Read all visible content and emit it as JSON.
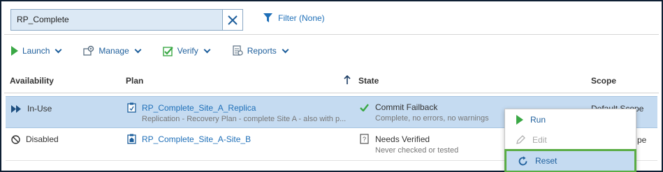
{
  "search": {
    "value": "RP_Complete"
  },
  "filter": {
    "label": "Filter (None)"
  },
  "toolbar": {
    "launch": "Launch",
    "manage": "Manage",
    "verify": "Verify",
    "reports": "Reports"
  },
  "columns": {
    "availability": "Availability",
    "plan": "Plan",
    "state": "State",
    "scope": "Scope"
  },
  "rows": [
    {
      "availability": "In-Use",
      "plan_name": "RP_Complete_Site_A_Replica",
      "plan_desc": "Replication - Recovery Plan - complete Site A - also with p...",
      "state": "Commit Failback",
      "state_detail": "Complete, no errors, no warnings",
      "scope": "Default Scope"
    },
    {
      "availability": "Disabled",
      "plan_name": "RP_Complete_Site_A-Site_B",
      "plan_desc": "",
      "state": "Needs Verified",
      "state_detail": "Never checked or tested",
      "scope": "pe"
    }
  ],
  "context_menu": {
    "run": "Run",
    "edit": "Edit",
    "reset": "Reset"
  },
  "colors": {
    "accent": "#1e6fb8",
    "selection": "#c5dbf1",
    "highlight": "#5aac44",
    "success": "#3aa845"
  }
}
